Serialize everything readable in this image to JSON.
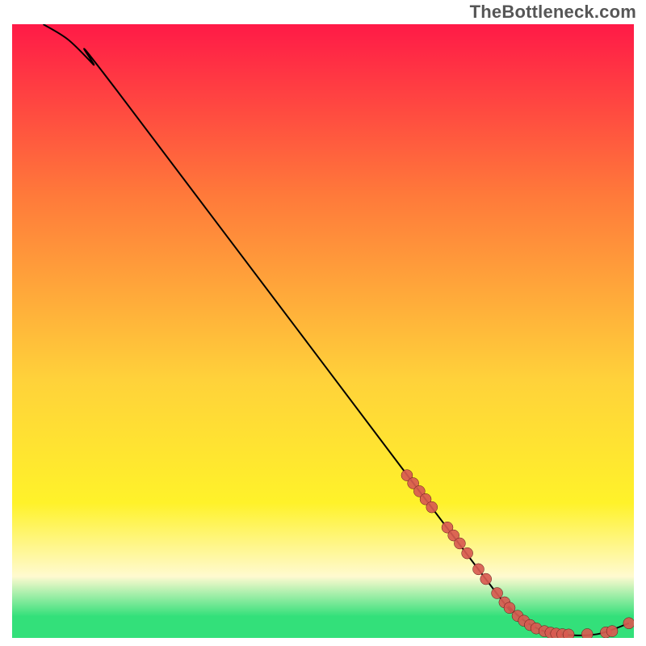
{
  "attribution": "TheBottleneck.com",
  "colors": {
    "grad_top": "#ff1a47",
    "grad_mid1": "#ff7a3a",
    "grad_mid2": "#ffd23a",
    "grad_mid3": "#fff22a",
    "grad_mid4": "#fffad0",
    "grad_green": "#33e07a",
    "line": "#000000",
    "marker_fill": "#d85a50",
    "marker_stroke": "#5a1818",
    "frame": "#000000"
  },
  "chart_data": {
    "type": "line",
    "title": "",
    "xlabel": "",
    "ylabel": "",
    "xlim": [
      0,
      100
    ],
    "ylim": [
      0,
      100
    ],
    "curve": [
      {
        "x": 5,
        "y": 100
      },
      {
        "x": 9,
        "y": 97.5
      },
      {
        "x": 13,
        "y": 93.5
      },
      {
        "x": 17,
        "y": 89
      },
      {
        "x": 74,
        "y": 12.5
      },
      {
        "x": 80,
        "y": 5
      },
      {
        "x": 84,
        "y": 1.8
      },
      {
        "x": 88,
        "y": 0.6
      },
      {
        "x": 94,
        "y": 0.6
      },
      {
        "x": 99.2,
        "y": 2.4
      }
    ],
    "markers": [
      {
        "x": 63.5,
        "y": 26.5
      },
      {
        "x": 64.5,
        "y": 25.2
      },
      {
        "x": 65.5,
        "y": 23.9
      },
      {
        "x": 66.5,
        "y": 22.6
      },
      {
        "x": 67.5,
        "y": 21.3
      },
      {
        "x": 70,
        "y": 18
      },
      {
        "x": 71,
        "y": 16.7
      },
      {
        "x": 72,
        "y": 15.4
      },
      {
        "x": 73.2,
        "y": 13.8
      },
      {
        "x": 75,
        "y": 11.2
      },
      {
        "x": 76.2,
        "y": 9.6
      },
      {
        "x": 78,
        "y": 7.3
      },
      {
        "x": 79.2,
        "y": 5.8
      },
      {
        "x": 80,
        "y": 4.9
      },
      {
        "x": 81.3,
        "y": 3.6
      },
      {
        "x": 82.3,
        "y": 2.8
      },
      {
        "x": 83.3,
        "y": 2.1
      },
      {
        "x": 84.3,
        "y": 1.55
      },
      {
        "x": 85.6,
        "y": 1.1
      },
      {
        "x": 86.6,
        "y": 0.85
      },
      {
        "x": 87.5,
        "y": 0.7
      },
      {
        "x": 88.5,
        "y": 0.6
      },
      {
        "x": 89.5,
        "y": 0.55
      },
      {
        "x": 92.5,
        "y": 0.6
      },
      {
        "x": 95.5,
        "y": 0.9
      },
      {
        "x": 96.5,
        "y": 1.1
      },
      {
        "x": 99.2,
        "y": 2.4
      }
    ]
  }
}
